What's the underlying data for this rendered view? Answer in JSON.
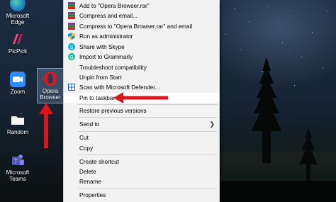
{
  "desktop": {
    "icons": [
      {
        "label": "Microsoft\nEdge"
      },
      {
        "label": "PicPick"
      },
      {
        "label": "Zoom"
      },
      {
        "label": "Opera\nBrowser"
      },
      {
        "label": "Random"
      },
      {
        "label": "Microsoft\nTeams"
      }
    ]
  },
  "context_menu": {
    "items": [
      {
        "label": "Add to \"Opera Browser.rar\"",
        "icon": "winrar-icon"
      },
      {
        "label": "Compress and email...",
        "icon": "winrar-icon"
      },
      {
        "label": "Compress to \"Opera Browser.rar\" and email",
        "icon": "winrar-icon"
      },
      {
        "label": "Run as administrator",
        "icon": "shield-icon"
      },
      {
        "label": "Share with Skype",
        "icon": "skype-icon"
      },
      {
        "label": "Import to Grammarly",
        "icon": "grammarly-icon"
      },
      {
        "label": "Troubleshoot compatibility",
        "icon": ""
      },
      {
        "label": "Unpin from Start",
        "icon": ""
      },
      {
        "label": "Scan with Microsoft Defender...",
        "icon": "defender-icon"
      },
      {
        "label": "Pin to taskbar",
        "icon": ""
      },
      {
        "label": "Restore previous versions",
        "icon": ""
      },
      {
        "label": "Send to",
        "icon": "chevron-right-icon"
      },
      {
        "label": "Cut",
        "icon": ""
      },
      {
        "label": "Copy",
        "icon": ""
      },
      {
        "label": "Create shortcut",
        "icon": ""
      },
      {
        "label": "Delete",
        "icon": ""
      },
      {
        "label": "Rename",
        "icon": ""
      },
      {
        "label": "Properties",
        "icon": ""
      }
    ],
    "highlighted": "Pin to taskbar"
  },
  "colors": {
    "annotation_arrow": "#d9161c",
    "menu_bg": "#f2f2f2",
    "highlight_bg": "#ffffff"
  }
}
